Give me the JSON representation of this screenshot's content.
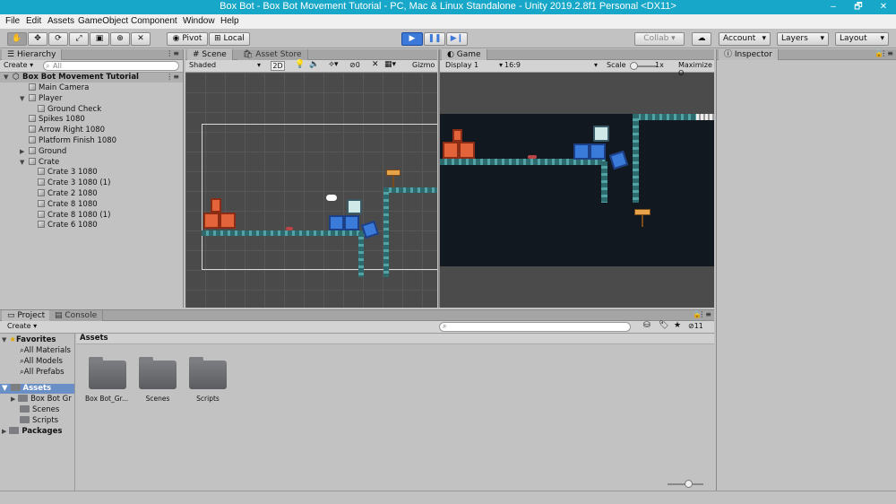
{
  "window": {
    "title": "Box Bot - Box Bot Movement Tutorial - PC, Mac & Linux Standalone - Unity 2019.2.8f1 Personal <DX11>",
    "minimize": "–",
    "maximize": "🗗",
    "close": "✕"
  },
  "menu": [
    "File",
    "Edit",
    "Assets",
    "GameObject",
    "Component",
    "Window",
    "Help"
  ],
  "toolbar": {
    "pivot": "Pivot",
    "local": "Local",
    "collab": "Collab ▾",
    "account": "Account",
    "layers": "Layers",
    "layout": "Layout"
  },
  "hierarchy": {
    "tab": "Hierarchy",
    "create": "Create ▾",
    "search_placeholder": "All",
    "scene": "Box Bot Movement Tutorial",
    "items": [
      {
        "label": "Main Camera",
        "indent": 1,
        "expand": ""
      },
      {
        "label": "Player",
        "indent": 1,
        "expand": "▼"
      },
      {
        "label": "Ground Check",
        "indent": 2,
        "expand": ""
      },
      {
        "label": "Spikes 1080",
        "indent": 1,
        "expand": ""
      },
      {
        "label": "Arrow Right 1080",
        "indent": 1,
        "expand": ""
      },
      {
        "label": "Platform Finish 1080",
        "indent": 1,
        "expand": ""
      },
      {
        "label": "Ground",
        "indent": 1,
        "expand": "▶"
      },
      {
        "label": "Crate",
        "indent": 1,
        "expand": "▼"
      },
      {
        "label": "Crate 3 1080",
        "indent": 2,
        "expand": ""
      },
      {
        "label": "Crate 3 1080 (1)",
        "indent": 2,
        "expand": ""
      },
      {
        "label": "Crate 2 1080",
        "indent": 2,
        "expand": ""
      },
      {
        "label": "Crate 8 1080",
        "indent": 2,
        "expand": ""
      },
      {
        "label": "Crate 8 1080 (1)",
        "indent": 2,
        "expand": ""
      },
      {
        "label": "Crate 6 1080",
        "indent": 2,
        "expand": ""
      }
    ]
  },
  "scene_view": {
    "tab_scene": "Scene",
    "tab_asset_store": "Asset Store",
    "shading": "Shaded",
    "mode_2d": "2D",
    "hidden_count": "0",
    "gizmos": "Gizmo"
  },
  "game_view": {
    "tab": "Game",
    "display": "Display 1",
    "aspect": "16:9",
    "scale_label": "Scale",
    "scale_value": "1x",
    "maximize": "Maximize O"
  },
  "inspector": {
    "tab": "Inspector"
  },
  "project": {
    "tab_project": "Project",
    "tab_console": "Console",
    "create": "Create ▾",
    "count": "11",
    "favorites_label": "Favorites",
    "favorites": [
      "All Materials",
      "All Models",
      "All Prefabs"
    ],
    "assets_label": "Assets",
    "asset_tree": [
      "Box Bot Gr",
      "Scenes",
      "Scripts"
    ],
    "packages_label": "Packages",
    "breadcrumb": "Assets",
    "folders": [
      "Box Bot_Gr...",
      "Scenes",
      "Scripts"
    ]
  },
  "colors": {
    "title_bar": "#17a7c9",
    "game_bg": "#121820",
    "scene_bg": "#4a4a4a",
    "play_active": "#3c78d8"
  }
}
